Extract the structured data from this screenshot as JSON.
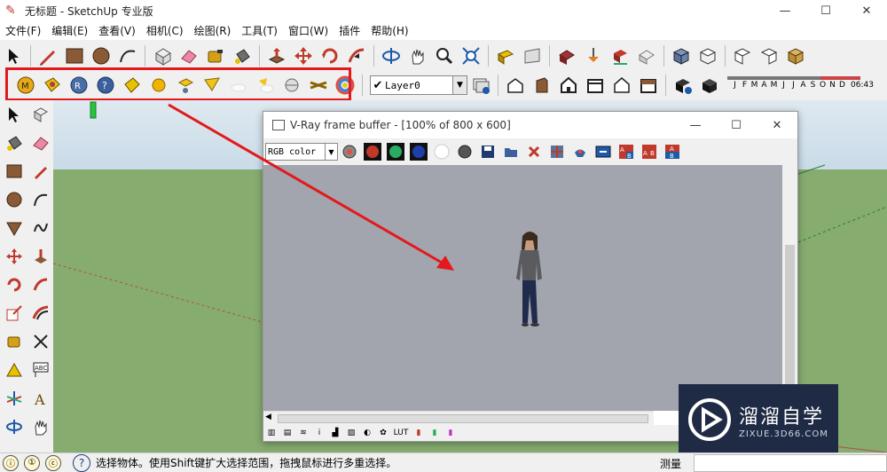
{
  "window": {
    "title": "无标题 - SketchUp 专业版",
    "minimize": "—",
    "maximize": "☐",
    "close": "✕"
  },
  "menu": [
    "文件(F)",
    "编辑(E)",
    "查看(V)",
    "相机(C)",
    "绘图(R)",
    "工具(T)",
    "窗口(W)",
    "插件",
    "帮助(H)"
  ],
  "layer": {
    "check": "✔",
    "name": "Layer0",
    "arrow": "▼"
  },
  "shadow": {
    "months": [
      "J",
      "F",
      "M",
      "A",
      "M",
      "J",
      "J",
      "A",
      "S",
      "O",
      "N",
      "D"
    ],
    "time": "06:43"
  },
  "vray": {
    "title": "V-Ray frame buffer - [100% of 800 x 600]",
    "minimize": "—",
    "maximize": "☐",
    "close": "✕",
    "channel": "RGB color",
    "status_icons": [
      "▥",
      "▤",
      "≋",
      "i",
      "▟",
      "▨",
      "◐",
      "✿",
      "LUT",
      "▮",
      "▮",
      "▮"
    ]
  },
  "watermark": {
    "main": "溜溜自学",
    "sub": "ZIXUE.3D66.COM"
  },
  "status": {
    "icons": [
      "ⓘ",
      "①",
      "ⓒ"
    ],
    "help": "?",
    "message": "选择物体。使用Shift键扩大选择范围，拖拽鼠标进行多重选择。",
    "measure": "测量"
  },
  "colors": {
    "highlight": "#e3191c",
    "arrow": "#e3191c",
    "ground": "#86ac70",
    "render_bg": "#a2a5ae"
  }
}
